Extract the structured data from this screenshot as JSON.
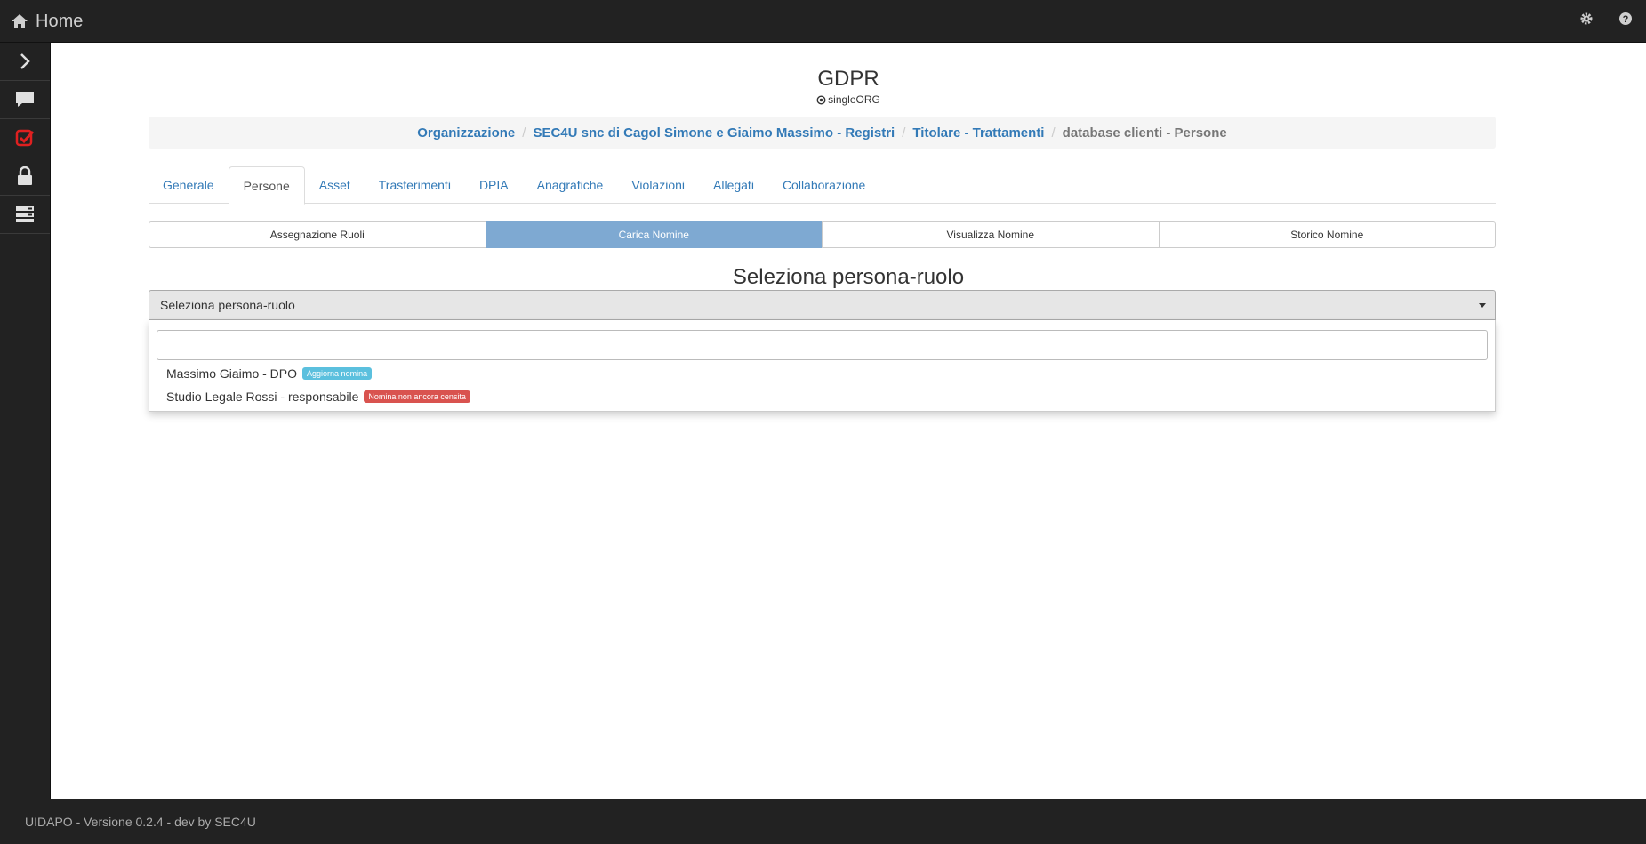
{
  "topbar": {
    "home_label": "Home"
  },
  "main": {
    "title": "GDPR",
    "subtitle": "singleORG",
    "breadcrumb": [
      "Organizzazione",
      "SEC4U snc di Cagol Simone e Giaimo Massimo - Registri",
      "Titolare - Trattamenti",
      "database clienti - Persone"
    ],
    "tabs": [
      "Generale",
      "Persone",
      "Asset",
      "Trasferimenti",
      "DPIA",
      "Anagrafiche",
      "Violazioni",
      "Allegati",
      "Collaborazione"
    ],
    "active_tab": "Persone",
    "subtabs": [
      "Assegnazione Ruoli",
      "Carica Nomine",
      "Visualizza Nomine",
      "Storico Nomine"
    ],
    "active_subtab": "Carica Nomine",
    "select_title": "Seleziona persona-ruolo",
    "select": {
      "value": "Seleziona persona-ruolo",
      "search_value": "",
      "options": [
        {
          "label": "Massimo Giaimo - DPO",
          "badge": "Aggiorna nomina",
          "badge_color": "#5bc0de"
        },
        {
          "label": "Studio Legale Rossi - responsabile",
          "badge": "Nomina non ancora censita",
          "badge_color": "#d9534f"
        }
      ]
    }
  },
  "footer": {
    "text": "UIDAPO - Versione 0.2.4 - dev by SEC4U"
  },
  "colors": {
    "accent": "#337ab7",
    "active_subtab": "#7ea9d2",
    "dark": "#222222",
    "checklist_icon": "#e02020"
  }
}
